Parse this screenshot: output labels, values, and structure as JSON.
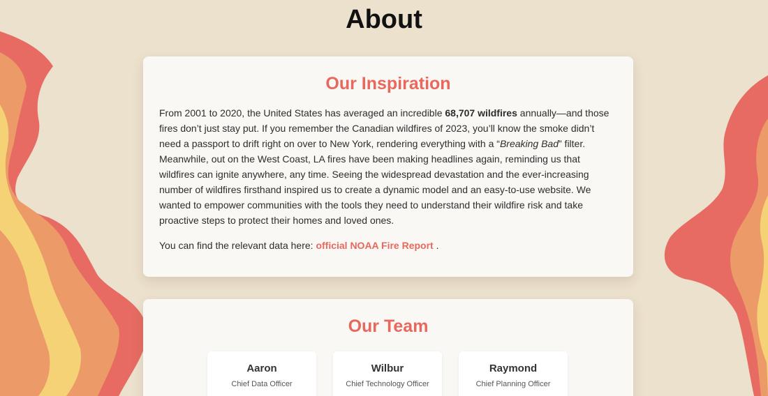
{
  "page": {
    "title": "About"
  },
  "inspiration": {
    "heading": "Our Inspiration",
    "text_1": "From 2001 to 2020, the United States has averaged an incredible ",
    "highlight": "68,707 wildfires",
    "text_2": " annually—and those fires don’t just stay put. If you remember the Canadian wildfires of 2023, you’ll know the smoke didn’t need a passport to drift right on over to New York, rendering everything with a “",
    "show_title": "Breaking Bad",
    "text_3": "” filter. Meanwhile, out on the West Coast, LA fires have been making headlines again, reminding us that wildfires can ignite anywhere, any time. Seeing the widespread devastation and the ever-increasing number of wildfires firsthand inspired us to create a dynamic model and an easy-to-use website. We wanted to empower communities with the tools they need to understand their wildfire risk and take proactive steps to protect their homes and loved ones.",
    "source_prefix": "You can find the relevant data here: ",
    "source_link": "official NOAA Fire Report",
    "source_suffix": " ."
  },
  "team": {
    "heading": "Our Team",
    "members": [
      {
        "name": "Aaron",
        "role": "Chief Data Officer"
      },
      {
        "name": "Wilbur",
        "role": "Chief Technology Officer"
      },
      {
        "name": "Raymond",
        "role": "Chief Planning Officer"
      }
    ]
  },
  "colors": {
    "background": "#ece1cd",
    "accent": "#e8685e",
    "flame_outer": "#e76b62",
    "flame_middle": "#ec9a67",
    "flame_inner": "#f5d275"
  }
}
